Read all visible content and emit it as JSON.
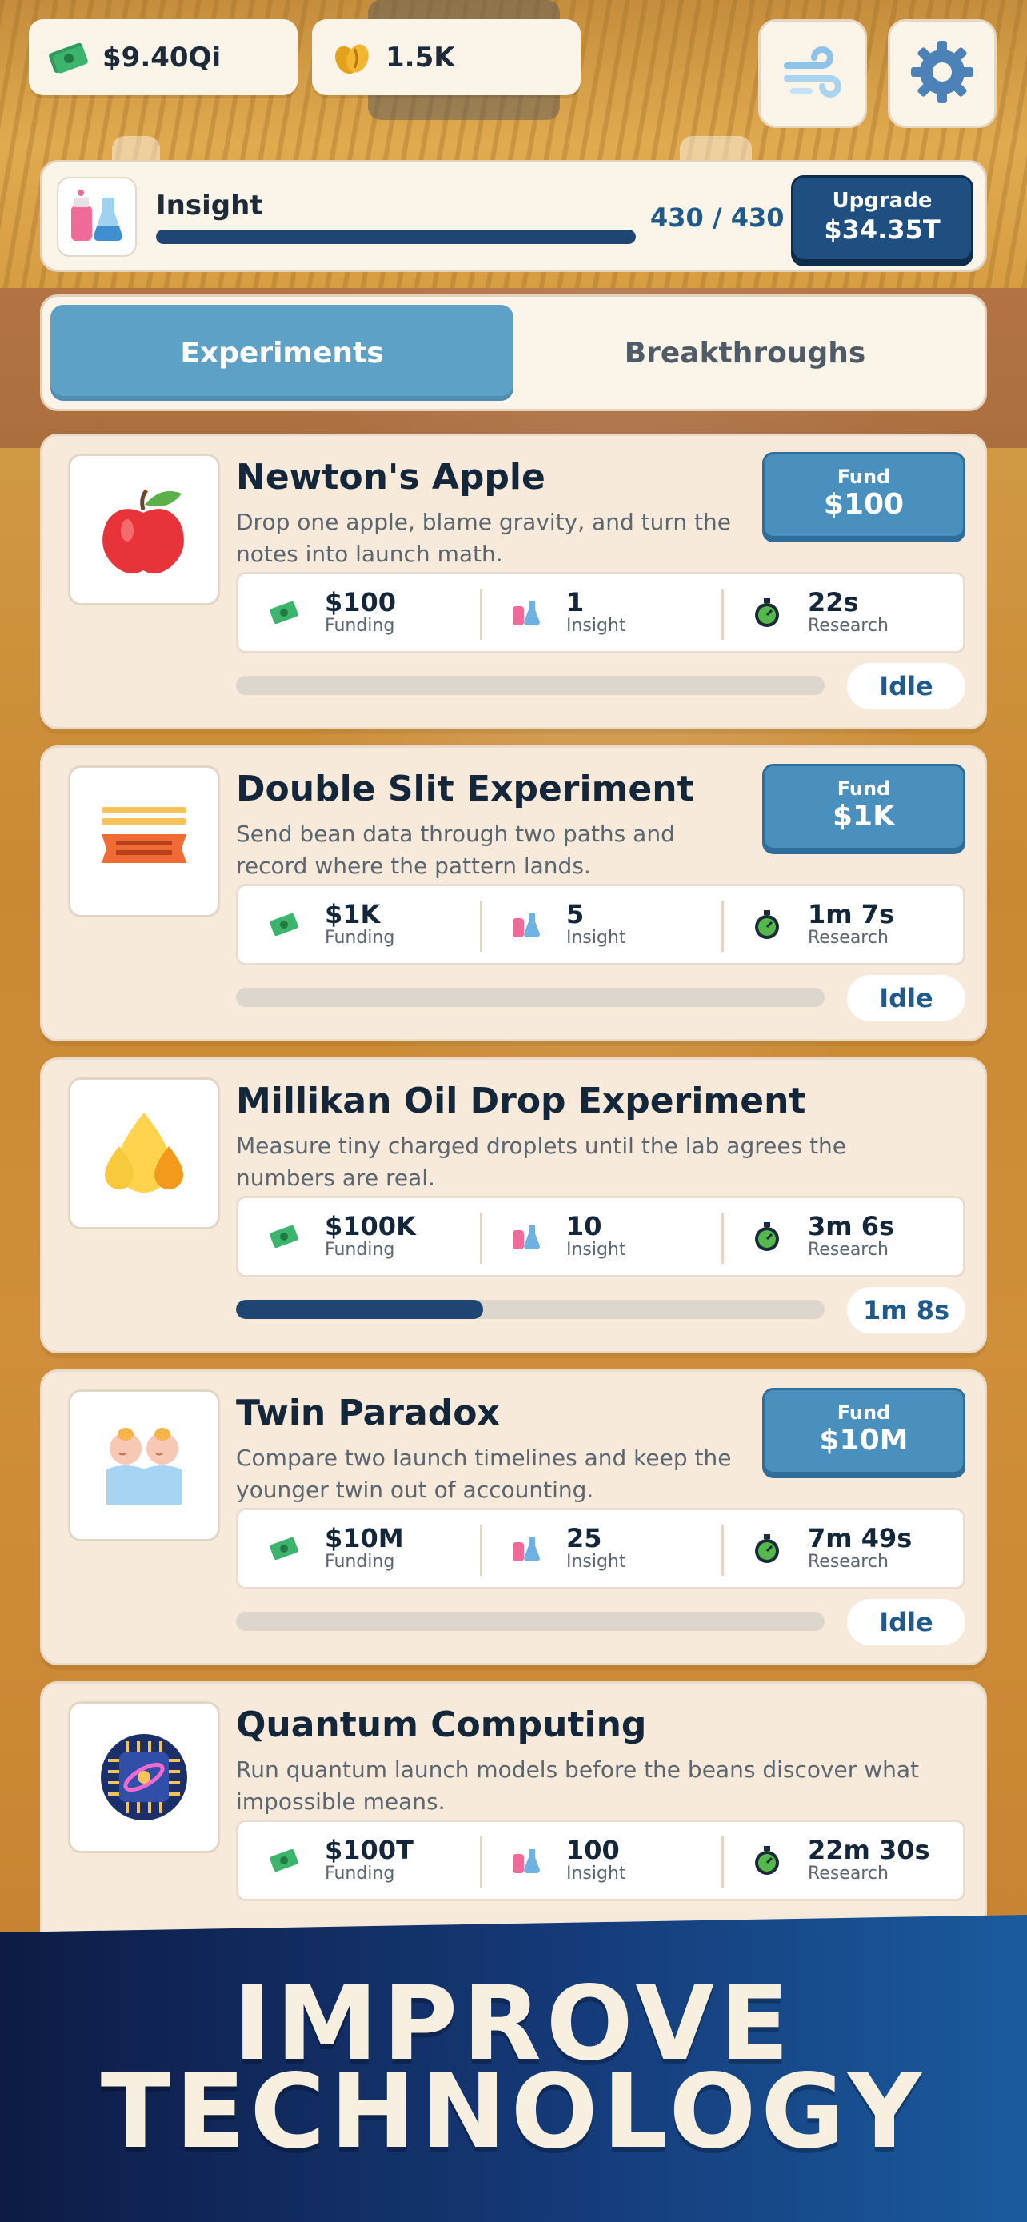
{
  "header": {
    "cash": "$9.40Qi",
    "beans": "1.5K",
    "cash_icon": "cash-icon",
    "beans_icon": "beans-icon",
    "wind_icon": "wind-icon",
    "settings_icon": "gear-icon"
  },
  "insight": {
    "label": "Insight",
    "count": "430 / 430",
    "progress": 1.0,
    "upgrade_label": "Upgrade",
    "upgrade_cost": "$34.35T"
  },
  "tabs": [
    {
      "label": "Experiments",
      "active": true
    },
    {
      "label": "Breakthroughs",
      "active": false
    }
  ],
  "labels": {
    "fund": "Fund",
    "funding": "Funding",
    "insight": "Insight",
    "research": "Research"
  },
  "experiments": [
    {
      "title": "Newton's Apple",
      "description": "Drop one apple, blame gravity, and turn the notes into launch math.",
      "fund_cost": "$100",
      "funding": "$100",
      "insight": "1",
      "research": "22s",
      "progress": 0,
      "status": "Idle",
      "icon": "apple-icon"
    },
    {
      "title": "Double Slit Experiment",
      "description": "Send bean data through two paths and record where the pattern lands.",
      "fund_cost": "$1K",
      "funding": "$1K",
      "insight": "5",
      "research": "1m 7s",
      "progress": 0,
      "status": "Idle",
      "icon": "double-slit-icon"
    },
    {
      "title": "Millikan Oil Drop Experiment",
      "description": "Measure tiny charged droplets until the lab agrees the numbers are real.",
      "funding": "$100K",
      "insight": "10",
      "research": "3m 6s",
      "progress": 0.42,
      "status": "1m 8s",
      "icon": "oil-drop-icon"
    },
    {
      "title": "Twin Paradox",
      "description": "Compare two launch timelines and keep the younger twin out of accounting.",
      "fund_cost": "$10M",
      "funding": "$10M",
      "insight": "25",
      "research": "7m 49s",
      "progress": 0,
      "status": "Idle",
      "icon": "twins-icon"
    },
    {
      "title": "Quantum Computing",
      "description": "Run quantum launch models before the beans discover what impossible means.",
      "funding": "$100T",
      "insight": "100",
      "research": "22m 30s",
      "icon": "quantum-chip-icon"
    }
  ],
  "banner": {
    "line1": "IMPROVE",
    "line2": "TECHNOLOGY"
  }
}
